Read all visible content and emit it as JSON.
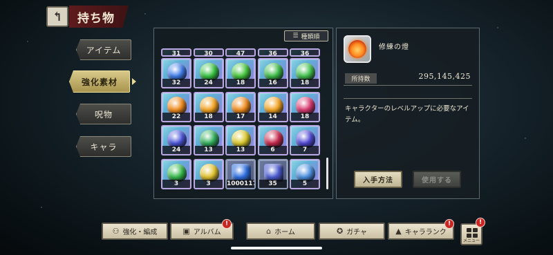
{
  "header": {
    "title": "持ち物",
    "back_icon": "back-arrow-icon"
  },
  "tabs": [
    {
      "label": "アイテム",
      "active": false
    },
    {
      "label": "強化素材",
      "active": true
    },
    {
      "label": "呪物",
      "active": false
    },
    {
      "label": "キャラ",
      "active": false
    }
  ],
  "sort": {
    "label": "種類順",
    "icon": "sort-icon"
  },
  "grid": {
    "partial_row": [
      "31",
      "30",
      "47",
      "36",
      "36"
    ],
    "rows": [
      [
        {
          "qty": "32",
          "color": "#3e7be8"
        },
        {
          "qty": "24",
          "color": "#35c23e"
        },
        {
          "qty": "18",
          "color": "#43c53a"
        },
        {
          "qty": "16",
          "color": "#3bbb45"
        },
        {
          "qty": "18",
          "color": "#40c04a"
        }
      ],
      [
        {
          "qty": "22",
          "color": "#f08a1a"
        },
        {
          "qty": "18",
          "color": "#f2a21e"
        },
        {
          "qty": "17",
          "color": "#f08a1a"
        },
        {
          "qty": "14",
          "color": "#f3a31f"
        },
        {
          "qty": "18",
          "color": "#d8386e"
        }
      ],
      [
        {
          "qty": "24",
          "color": "#4a55d8"
        },
        {
          "qty": "13",
          "color": "#2fae59"
        },
        {
          "qty": "13",
          "color": "#d9c82a"
        },
        {
          "qty": "6",
          "color": "#c8284b"
        },
        {
          "qty": "7",
          "color": "#4f48d4"
        }
      ],
      [
        {
          "qty": "3",
          "color": "#35b94a"
        },
        {
          "qty": "3",
          "color": "#e0c12a"
        },
        {
          "qty": "1000117",
          "color": "#2d6fe0",
          "special": true
        },
        {
          "qty": "35",
          "color": "#4a5bd0",
          "special": true
        },
        {
          "qty": "5",
          "color": "#4b8fe0"
        }
      ]
    ]
  },
  "detail": {
    "name": "修練の燈",
    "owned_label": "所持数",
    "owned_value": "295,145,425",
    "description": "キャラクターのレベルアップに必要なアイテム。",
    "acquire_label": "入手方法",
    "use_label": "使用する"
  },
  "bottom_nav": [
    {
      "label": "強化・編成",
      "icon": "people-icon",
      "badge": ""
    },
    {
      "label": "アルバム",
      "icon": "album-icon",
      "badge": "!"
    },
    {
      "label": "ホーム",
      "icon": "house-icon",
      "badge": ""
    },
    {
      "label": "ガチャ",
      "icon": "gacha-icon",
      "badge": ""
    },
    {
      "label": "キャラランク",
      "icon": "rank-icon",
      "badge": "!"
    }
  ],
  "menu": {
    "label": "メニュー",
    "badge": "!"
  }
}
